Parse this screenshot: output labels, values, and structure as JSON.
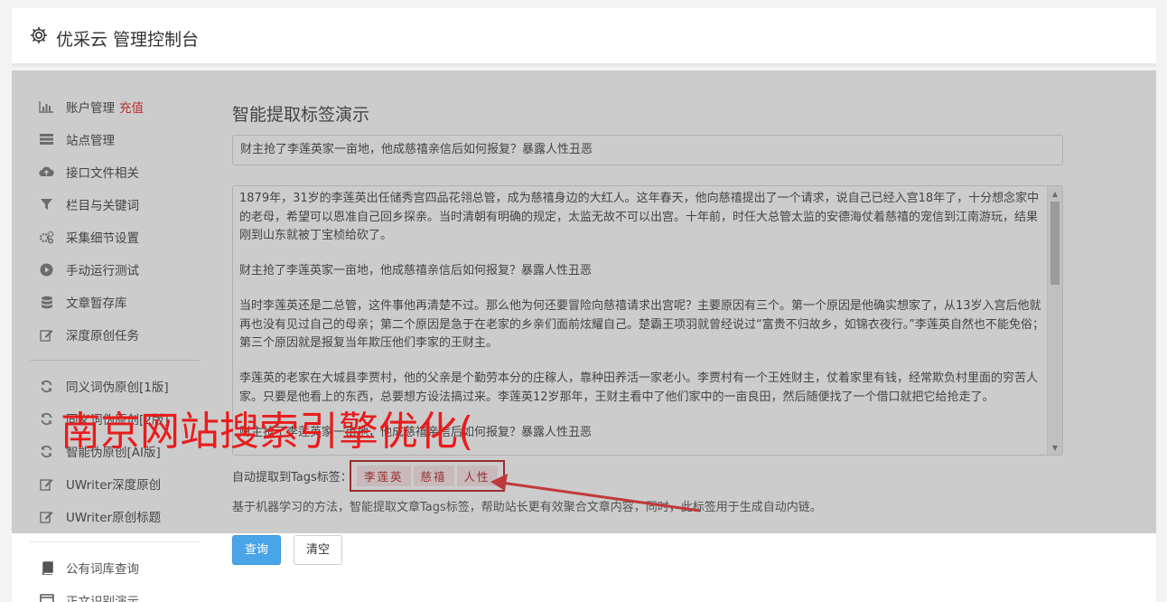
{
  "header": {
    "title": "优采云 管理控制台",
    "icon": "gear-icon"
  },
  "sidebar": {
    "items": [
      {
        "label": "账户管理",
        "badge": "充值",
        "icon": "bar-chart-icon"
      },
      {
        "label": "站点管理",
        "icon": "list-icon"
      },
      {
        "label": "接口文件相关",
        "icon": "cloud-upload-icon"
      },
      {
        "label": "栏目与关键词",
        "icon": "filter-icon"
      },
      {
        "label": "采集细节设置",
        "icon": "gears-icon"
      },
      {
        "label": "手动运行测试",
        "icon": "play-icon"
      },
      {
        "label": "文章暂存库",
        "icon": "database-icon"
      },
      {
        "label": "深度原创任务",
        "icon": "edit-icon"
      },
      {
        "label": "同义词伪原创[1版]",
        "icon": "refresh-icon"
      },
      {
        "label": "同义词伪原创[2版]",
        "icon": "refresh-icon"
      },
      {
        "label": "智能伪原创[AI版]",
        "icon": "refresh-icon"
      },
      {
        "label": "UWriter深度原创",
        "icon": "edit-icon"
      },
      {
        "label": "UWriter原创标题",
        "icon": "edit-icon"
      },
      {
        "label": "公有词库查询",
        "icon": "book-icon"
      },
      {
        "label": "正文识别演示",
        "icon": "window-icon"
      }
    ]
  },
  "main": {
    "heading": "智能提取标签演示",
    "title_value": "财主抢了李莲英家一亩地，他成慈禧亲信后如何报复？暴露人性丑恶",
    "article_paragraphs": [
      "1879年，31岁的李莲英出任储秀宫四品花翎总管，成为慈禧身边的大红人。这年春天，他向慈禧提出了一个请求，说自己已经入宫18年了，十分想念家中的老母，希望可以恩准自己回乡探亲。当时清朝有明确的规定，太监无故不可以出宫。十年前，时任大总管太监的安德海仗着慈禧的宠信到江南游玩，结果刚到山东就被丁宝桢给砍了。",
      "财主抢了李莲英家一亩地，他成慈禧亲信后如何报复？暴露人性丑恶",
      "当时李莲英还是二总管，这件事他再清楚不过。那么他为何还要冒险向慈禧请求出宫呢？主要原因有三个。第一个原因是他确实想家了，从13岁入宫后他就再也没有见过自己的母亲；第二个原因是急于在老家的乡亲们面前炫耀自己。楚霸王项羽就曾经说过“富贵不归故乡，如锦衣夜行。”李莲英自然也不能免俗；第三个原因就是报复当年欺压他们李家的王财主。",
      "李莲英的老家在大城县李贾村，他的父亲是个勤劳本分的庄稼人，靠种田养活一家老小。李贾村有一个王姓财主，仗着家里有钱，经常欺负村里面的穷苦人家。只要是他看上的东西，总要想方设法搞过来。李莲英12岁那年，王财主看中了他们家中的一亩良田，然后随便找了一个借口就把它给抢走了。",
      "财主抢了李莲英家一亩地，他成慈禧亲信后如何报复？暴露人性丑恶"
    ],
    "tags_label": "自动提取到Tags标签：",
    "tags": [
      "李莲英",
      "慈禧",
      "人性"
    ],
    "description": "基于机器学习的方法，智能提取文章Tags标签，帮助站长更有效聚合文章内容，同时，此标签用于生成自动内链。",
    "query_button": "查询",
    "clear_button": "清空"
  },
  "overlay": {
    "watermark_text": "南京网站搜索引擎优化("
  }
}
